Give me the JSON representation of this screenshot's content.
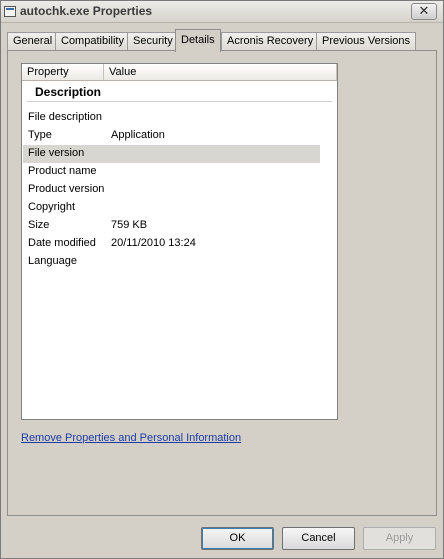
{
  "window": {
    "title": "autochk.exe  Properties",
    "close_glyph": "✕"
  },
  "tabs": [
    {
      "label": "General",
      "active": false
    },
    {
      "label": "Compatibility",
      "active": false
    },
    {
      "label": "Security",
      "active": false
    },
    {
      "label": "Details",
      "active": true
    },
    {
      "label": "Acronis Recovery",
      "active": false
    },
    {
      "label": "Previous Versions",
      "active": false
    }
  ],
  "details": {
    "columns": {
      "property": "Property",
      "value": "Value"
    },
    "section": "Description",
    "rows": [
      {
        "property": "File description",
        "value": ""
      },
      {
        "property": "Type",
        "value": "Application"
      },
      {
        "property": "File version",
        "value": "",
        "selected": true
      },
      {
        "property": "Product name",
        "value": ""
      },
      {
        "property": "Product version",
        "value": ""
      },
      {
        "property": "Copyright",
        "value": ""
      },
      {
        "property": "Size",
        "value": "759 KB"
      },
      {
        "property": "Date modified",
        "value": "20/11/2010 13:24"
      },
      {
        "property": "Language",
        "value": ""
      }
    ]
  },
  "remove_link": "Remove Properties and Personal Information",
  "buttons": {
    "ok": "OK",
    "cancel": "Cancel",
    "apply": "Apply"
  }
}
